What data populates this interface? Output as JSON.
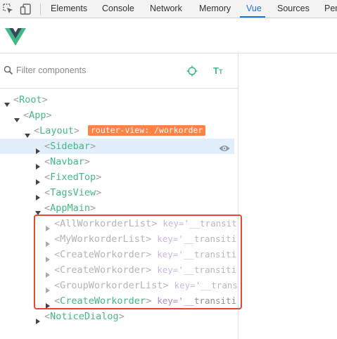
{
  "devtools": {
    "tabs": [
      {
        "label": "Elements"
      },
      {
        "label": "Console"
      },
      {
        "label": "Network"
      },
      {
        "label": "Memory"
      },
      {
        "label": "Vue"
      },
      {
        "label": "Sources"
      },
      {
        "label": "Perf"
      }
    ],
    "active_tab": "Vue"
  },
  "filter": {
    "placeholder": "Filter components",
    "value": ""
  },
  "tree": {
    "root": "Root",
    "app": "App",
    "layout": "Layout",
    "layout_badge": "router-view: /workorder",
    "sidebar": "Sidebar",
    "navbar": "Navbar",
    "fixedtop": "FixedTop",
    "tagsview": "TagsView",
    "appmain": "AppMain",
    "children": [
      {
        "name": "AllWorkorderList",
        "key": "key=",
        "val": "'__transiti"
      },
      {
        "name": "MyWorkorderList",
        "key": "key=",
        "val": "'__transiti"
      },
      {
        "name": "CreateWorkorder",
        "key": "key=",
        "val": "'__transiti"
      },
      {
        "name": "CreateWorkorder",
        "key": "key=",
        "val": "'__transiti"
      },
      {
        "name": "GroupWorkorderList",
        "key": "key=",
        "val": "'__trans"
      },
      {
        "name": "CreateWorkorder",
        "key": "key=",
        "val": "'__transiti"
      }
    ],
    "noticedialog": "NoticeDialog"
  },
  "colors": {
    "vue_green": "#42b983",
    "accent_blue": "#1a73e8",
    "badge_orange": "#ff8344",
    "highlight_red": "#e8462f"
  }
}
